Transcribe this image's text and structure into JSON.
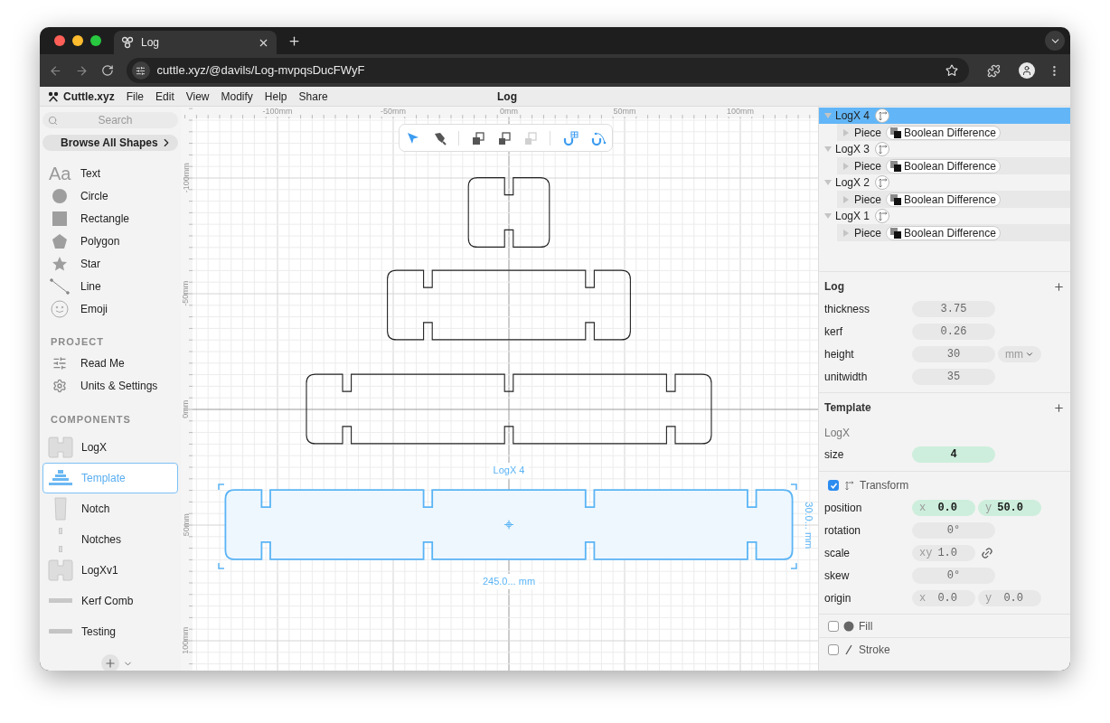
{
  "browser": {
    "tab_title": "Log",
    "url": "cuttle.xyz/@davils/Log-mvpqsDucFWyF"
  },
  "app": {
    "brand": "Cuttle.xyz",
    "menu": [
      "File",
      "Edit",
      "View",
      "Modify",
      "Help",
      "Share"
    ],
    "document_title": "Log"
  },
  "sidebar": {
    "search": {
      "placeholder": "Search"
    },
    "browse_button": "Browse All Shapes",
    "shapes": [
      {
        "label": "Text",
        "kind": "text",
        "glyph": "Aa"
      },
      {
        "label": "Circle",
        "kind": "circle"
      },
      {
        "label": "Rectangle",
        "kind": "rectangle"
      },
      {
        "label": "Polygon",
        "kind": "polygon"
      },
      {
        "label": "Star",
        "kind": "star"
      },
      {
        "label": "Line",
        "kind": "line"
      },
      {
        "label": "Emoji",
        "kind": "emoji"
      }
    ],
    "project_heading": "PROJECT",
    "project_items": [
      {
        "label": "Read Me",
        "kind": "readme"
      },
      {
        "label": "Units & Settings",
        "kind": "settings"
      }
    ],
    "components_heading": "COMPONENTS",
    "components": [
      {
        "label": "LogX",
        "kind": "log",
        "selected": false
      },
      {
        "label": "Template",
        "kind": "template",
        "selected": true
      },
      {
        "label": "Notch",
        "kind": "notch",
        "selected": false
      },
      {
        "label": "Notches",
        "kind": "notches",
        "selected": false
      },
      {
        "label": "LogXv1",
        "kind": "log",
        "selected": false
      },
      {
        "label": "Kerf Comb",
        "kind": "comb",
        "selected": false
      },
      {
        "label": "Testing",
        "kind": "bar",
        "selected": false
      }
    ]
  },
  "canvas": {
    "ruler_x": [
      "-100mm",
      "-50mm",
      "0mm",
      "50mm",
      "100mm"
    ],
    "ruler_y": [
      "-100mm",
      "-50mm",
      "0mm",
      "50mm",
      "100mm"
    ],
    "tools": [
      {
        "kind": "pointer",
        "selected": true
      },
      {
        "kind": "pen",
        "selected": false
      }
    ],
    "actions": [
      {
        "kind": "union",
        "disabled": false
      },
      {
        "kind": "difference",
        "disabled": false
      },
      {
        "kind": "intersect",
        "disabled": true
      }
    ],
    "snaps": [
      {
        "kind": "grid",
        "on": true
      },
      {
        "kind": "geometry",
        "on": true
      }
    ],
    "selection": {
      "label": "LogX 4",
      "width": "245.0... mm",
      "height": "30.0... mm"
    }
  },
  "layers": [
    {
      "name": "LogX 4",
      "selected": true,
      "expanded": true,
      "children": [
        {
          "name": "Piece",
          "expanded": false,
          "badge": "Boolean Difference"
        }
      ]
    },
    {
      "name": "LogX 3",
      "selected": false,
      "expanded": true,
      "children": [
        {
          "name": "Piece",
          "expanded": false,
          "badge": "Boolean Difference"
        }
      ]
    },
    {
      "name": "LogX 2",
      "selected": false,
      "expanded": true,
      "children": [
        {
          "name": "Piece",
          "expanded": false,
          "badge": "Boolean Difference"
        }
      ]
    },
    {
      "name": "LogX 1",
      "selected": false,
      "expanded": true,
      "children": [
        {
          "name": "Piece",
          "expanded": false,
          "badge": "Boolean Difference"
        }
      ]
    }
  ],
  "log_params": {
    "title": "Log",
    "fields": [
      {
        "label": "thickness",
        "value": "3.75"
      },
      {
        "label": "kerf",
        "value": "0.26"
      },
      {
        "label": "height",
        "value": "30",
        "unit": "mm"
      },
      {
        "label": "unitwidth",
        "value": "35"
      }
    ]
  },
  "template": {
    "title": "Template",
    "component": "LogX",
    "fields": [
      {
        "label": "size",
        "value": "4",
        "modified": true
      }
    ]
  },
  "transform": {
    "label": "Transform",
    "checked": true,
    "rows": [
      {
        "label": "position",
        "parts": [
          {
            "axis": "x",
            "value": "0.0",
            "modified": true
          },
          {
            "axis": "y",
            "value": "50.0",
            "modified": true
          }
        ]
      },
      {
        "label": "rotation",
        "parts": [
          {
            "value": "0°",
            "modified": false
          }
        ]
      },
      {
        "label": "scale",
        "parts": [
          {
            "axis": "xy",
            "value": "1.0",
            "modified": false
          }
        ],
        "linked": true
      },
      {
        "label": "skew",
        "parts": [
          {
            "value": "0°",
            "modified": false
          }
        ]
      },
      {
        "label": "origin",
        "parts": [
          {
            "axis": "x",
            "value": "0.0",
            "modified": false
          },
          {
            "axis": "y",
            "value": "0.0",
            "modified": false
          }
        ]
      }
    ]
  },
  "fill": {
    "label": "Fill",
    "checked": false
  },
  "stroke": {
    "label": "Stroke",
    "checked": false
  }
}
